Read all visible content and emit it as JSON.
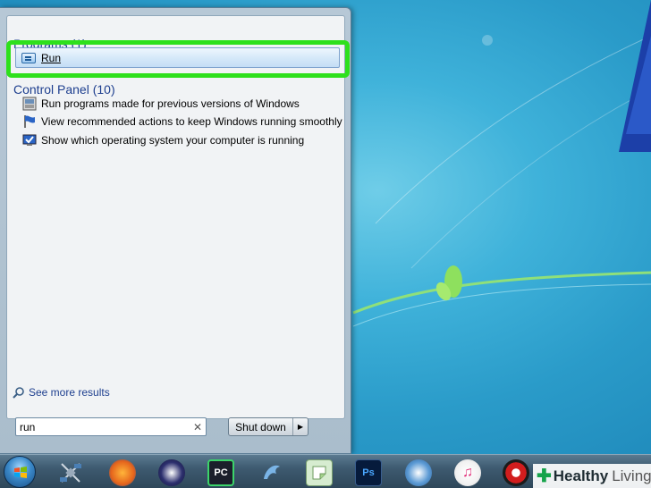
{
  "start_menu": {
    "programs_group": "Programs (1)",
    "run_item": "Run",
    "control_panel_group": "Control Panel (10)",
    "control_panel_items": [
      "Run programs made for previous versions of Windows",
      "View recommended actions to keep Windows running smoothly",
      "Show which operating system your computer is running"
    ],
    "see_more": "See more results",
    "search_value": "run",
    "search_clear": "✕",
    "shutdown_label": "Shut down",
    "shutdown_arrow": "▶"
  },
  "taskbar": {
    "icons": [
      "start-orb",
      "satellite-icon",
      "firefox-icon",
      "eclipse-icon",
      "pycharm-icon",
      "dolphin-icon",
      "clipboard-app-icon",
      "photoshop-icon",
      "internet-globe-icon",
      "itunes-icon",
      "pokeball-icon"
    ],
    "pycharm_label": "PC",
    "photoshop_label": "Ps",
    "itunes_glyph": "♫"
  },
  "watermark": {
    "plus": "✚",
    "brand": "Healthy",
    "brand2": "Living"
  },
  "colors": {
    "highlight": "#2ee01c",
    "group_title": "#1e3f8f",
    "desktop": "#2a9bc9"
  }
}
